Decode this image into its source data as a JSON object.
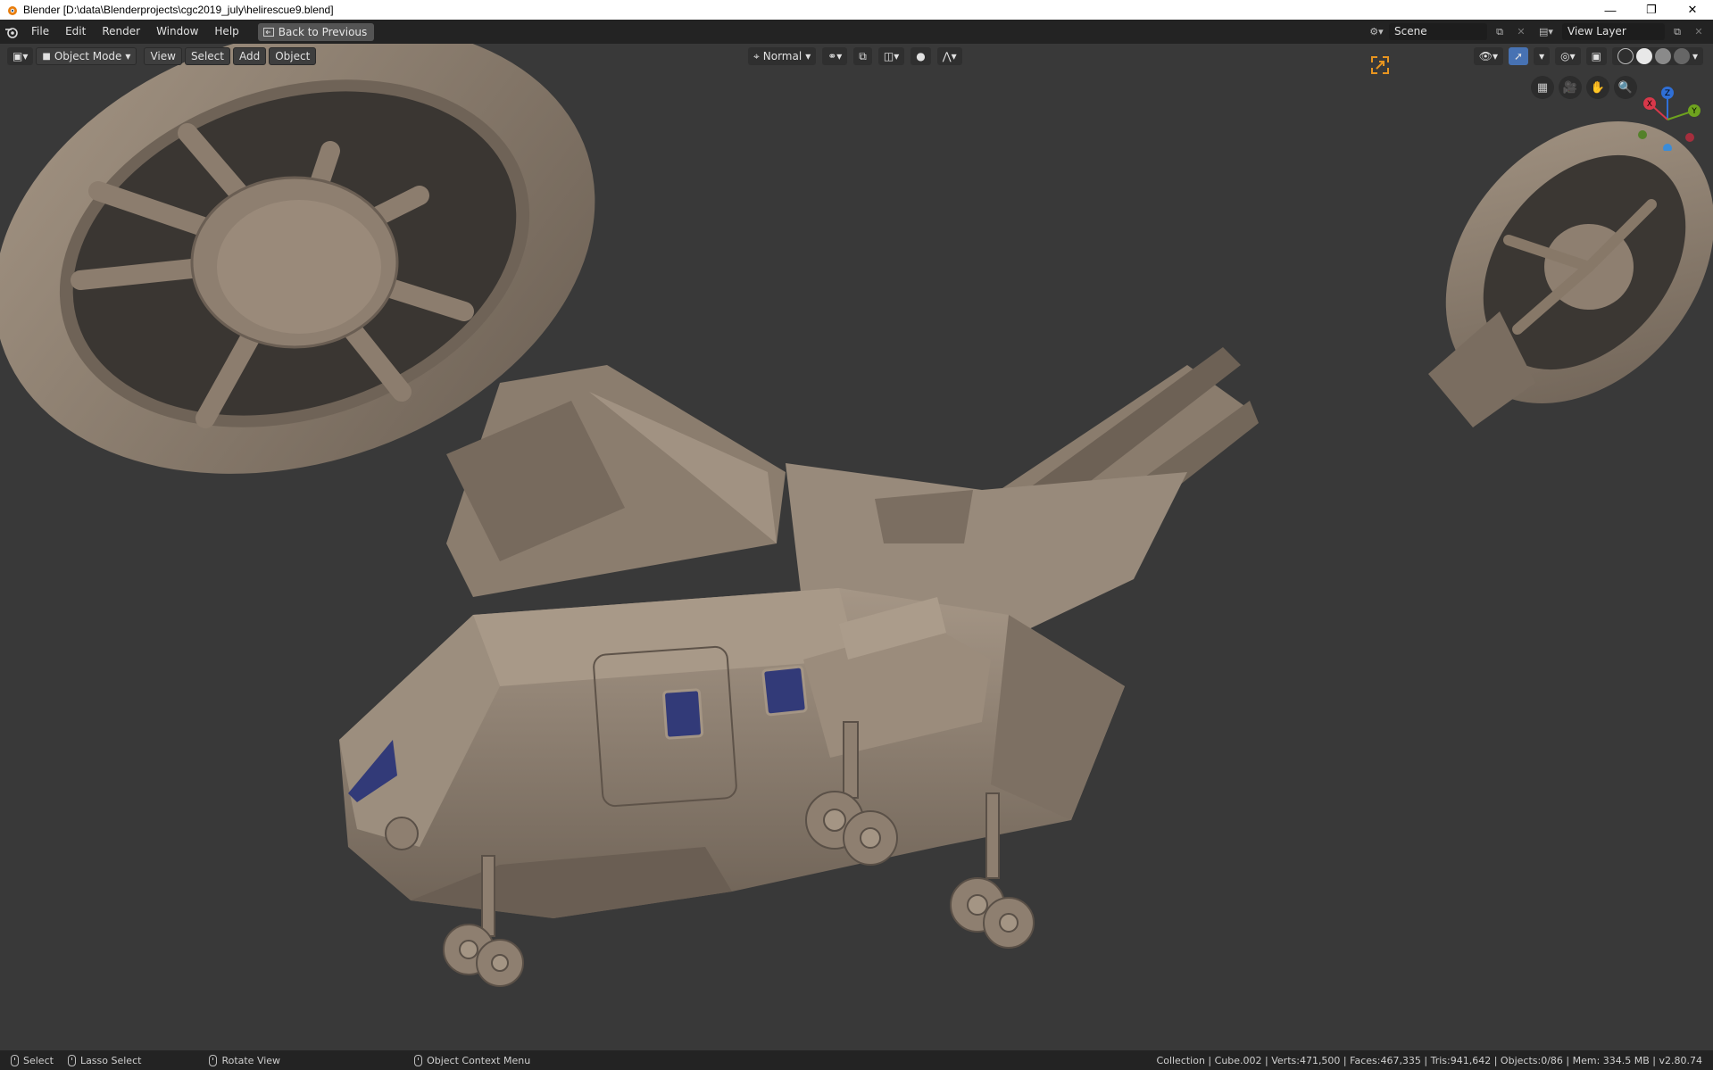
{
  "window": {
    "title": "Blender [D:\\data\\Blenderprojects\\cgc2019_july\\helirescue9.blend]",
    "minimize_icon": "minimize-icon",
    "restore_icon": "restore-icon",
    "close_icon": "close-icon"
  },
  "topbar": {
    "menus": [
      "File",
      "Edit",
      "Render",
      "Window",
      "Help"
    ],
    "back_label": "Back to Previous",
    "scene_value": "Scene",
    "view_layer_value": "View Layer"
  },
  "viewport_header": {
    "mode": "Object Mode",
    "menus": [
      "View",
      "Select",
      "Add",
      "Object"
    ],
    "transform_orientation": "Normal"
  },
  "statusbar": {
    "select": "Select",
    "lasso": "Lasso Select",
    "rotate": "Rotate View",
    "context_menu": "Object Context Menu",
    "stats": "Collection | Cube.002 | Verts:471,500 | Faces:467,335 | Tris:941,642 | Objects:0/86 | Mem: 334.5 MB | v2.80.74"
  },
  "gizmo": {
    "x": "X",
    "y": "Y",
    "z": "Z"
  },
  "colors": {
    "viewport_bg": "#393939",
    "model": "#8d7e70",
    "window_glass": "#323a78",
    "accent_blue": "#4772b3"
  }
}
